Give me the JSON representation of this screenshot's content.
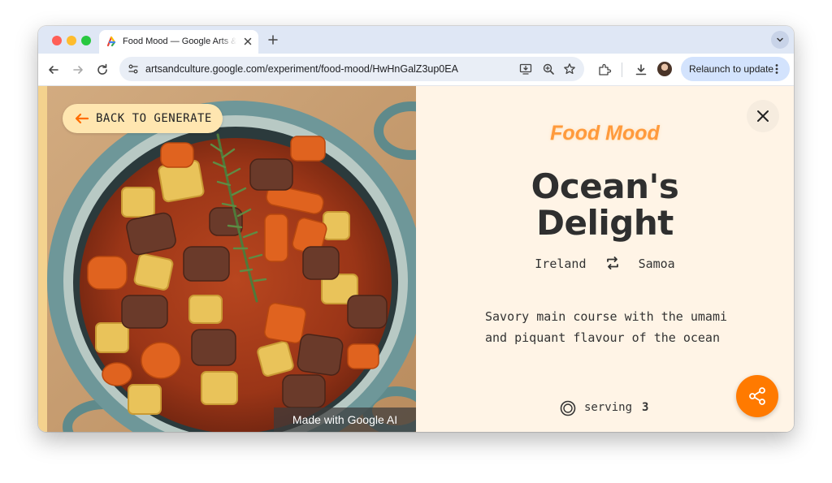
{
  "browser": {
    "tab": {
      "title": "Food Mood — Google Arts & Culture"
    },
    "toolbar": {
      "url": "artsandculture.google.com/experiment/food-mood/HwHnGalZ3up0EA",
      "relaunch_label": "Relaunch to update"
    }
  },
  "page": {
    "back_button_label": "BACK TO GENERATE",
    "image_credit": "Made with Google AI",
    "brand": "Food Mood",
    "dish_title_line1": "Ocean's",
    "dish_title_line2": "Delight",
    "country_a": "Ireland",
    "country_b": "Samoa",
    "description": "Savory main course with the umami and piquant flavour of the ocean",
    "serving_label": "serving",
    "serving_count": "3"
  },
  "colors": {
    "accent": "#ff7a00",
    "brand_text": "#ff9a3c",
    "panel_bg": "#fff4e6",
    "back_button_bg": "#ffe6b0"
  },
  "icons": [
    "back-arrow-icon",
    "forward-arrow-icon",
    "reload-icon",
    "site-info-icon",
    "install-app-icon",
    "zoom-icon",
    "bookmark-star-icon",
    "extensions-icon",
    "download-icon",
    "close-icon",
    "swap-icon",
    "serving-icon",
    "share-icon"
  ]
}
